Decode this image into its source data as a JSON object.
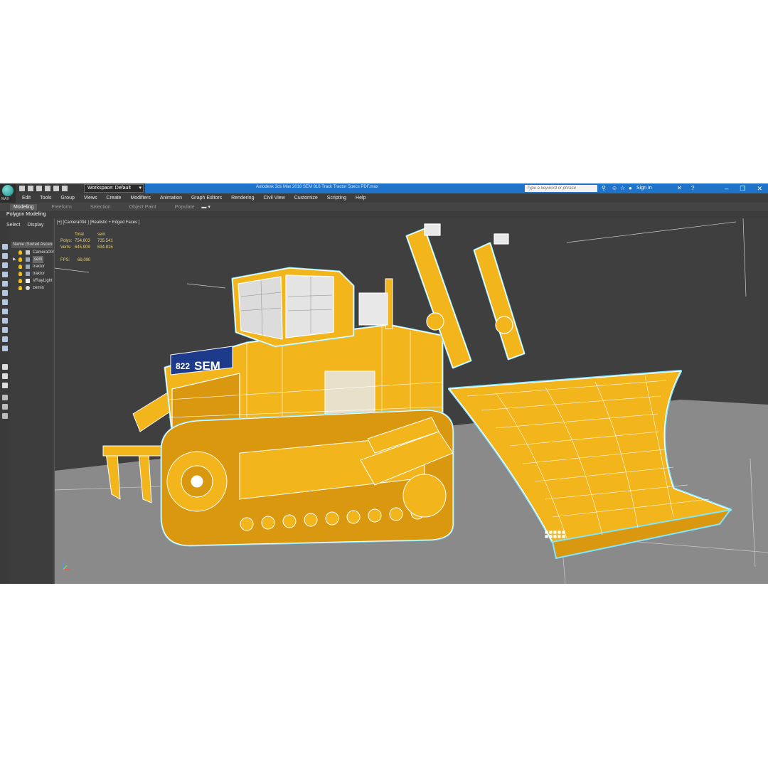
{
  "app": {
    "logo_label": "MAX",
    "workspace": "Workspace: Default",
    "window_title": "Autodesk 3ds Max 2018    SEM 816 Track Tractor Specs PDF.max",
    "search_placeholder": "Type a keyword or phrase",
    "sign_in": "Sign In",
    "help_icon": "?",
    "window_buttons": [
      "–",
      "❐",
      "✕"
    ]
  },
  "menubar": {
    "items": [
      "Edit",
      "Tools",
      "Group",
      "Views",
      "Create",
      "Modifiers",
      "Animation",
      "Graph Editors",
      "Rendering",
      "Civil View",
      "Customize",
      "Scripting",
      "Help"
    ]
  },
  "ribbon": {
    "tabs": [
      "Modeling",
      "Freeform",
      "Selection",
      "Object Paint",
      "Populate"
    ],
    "sub_label": "Polygon Modeling"
  },
  "scene_explorer": {
    "tabs": [
      "Select",
      "Display"
    ],
    "header": "Name (Sorted Ascending)",
    "rows": [
      {
        "name": "Camera004",
        "selected": false
      },
      {
        "name": "sem",
        "selected": true
      },
      {
        "name": "traktor",
        "selected": false
      },
      {
        "name": "traktor",
        "selected": false
      },
      {
        "name": "VRayLight",
        "selected": false
      },
      {
        "name": "zemin",
        "selected": false
      }
    ]
  },
  "viewport": {
    "label": "[+] [Camera004 ] [Realistic + Edged Faces ]",
    "stats": {
      "col_total": "Total",
      "col_sem": "sem",
      "polys_label": "Polys:",
      "polys_total": "754.603",
      "polys_sem": "735.541",
      "verts_label": "Verts:",
      "verts_total": "645.909",
      "verts_sem": "634.815",
      "fps_label": "FPS:",
      "fps_value": "69,090"
    },
    "model_badge": "822",
    "model_brand": "SEM",
    "colors": {
      "body": "#f2b51c",
      "body_dark": "#d9980f",
      "wire": "#ffffff",
      "outline": "#7fe7ff",
      "floor": "#8a8a8a",
      "background": "#3f3f3f"
    }
  }
}
